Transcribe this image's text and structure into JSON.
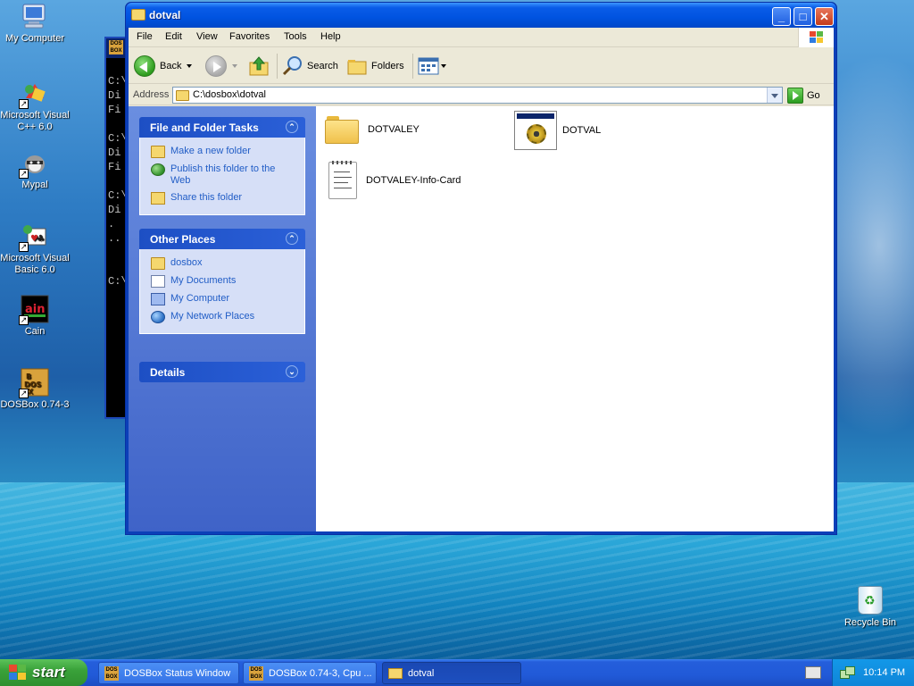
{
  "desktop": {
    "icons": [
      {
        "label": "My Computer",
        "icon": "my-computer-icon"
      },
      {
        "label": "Microsoft Visual C++ 6.0",
        "icon": "visual-cpp-icon"
      },
      {
        "label": "Mypal",
        "icon": "mypal-icon"
      },
      {
        "label": "Microsoft Visual Basic 6.0",
        "icon": "visual-basic-icon"
      },
      {
        "label": "Cain",
        "icon": "cain-icon"
      },
      {
        "label": "DOSBox 0.74-3",
        "icon": "dosbox-icon"
      }
    ],
    "recycle_bin": {
      "label": "Recycle Bin",
      "icon": "recycle-bin-icon"
    }
  },
  "dos_window": {
    "lines": [
      "C:\\",
      "Di",
      "Fi",
      "",
      "C:\\",
      "Di",
      "Fi",
      "",
      "C:\\",
      "Di",
      ".",
      "..",
      "",
      "",
      "C:\\"
    ]
  },
  "window": {
    "title": "dotval",
    "menu": [
      "File",
      "Edit",
      "View",
      "Favorites",
      "Tools",
      "Help"
    ],
    "toolbar": {
      "back": "Back",
      "search": "Search",
      "folders": "Folders"
    },
    "address": {
      "label": "Address",
      "value": "C:\\dosbox\\dotval",
      "go": "Go"
    },
    "tasks": {
      "file_folder_tasks": {
        "title": "File and Folder Tasks",
        "items": [
          "Make a new folder",
          "Publish this folder to the Web",
          "Share this folder"
        ]
      },
      "other_places": {
        "title": "Other Places",
        "items": [
          "dosbox",
          "My Documents",
          "My Computer",
          "My Network Places"
        ]
      },
      "details": {
        "title": "Details"
      }
    },
    "files": [
      {
        "name": "DOTVALEY",
        "type": "folder"
      },
      {
        "name": "DOTVAL",
        "type": "application"
      },
      {
        "name": "DOTVALEY-Info-Card",
        "type": "text"
      }
    ]
  },
  "taskbar": {
    "start": "start",
    "tasks": [
      {
        "label": "DOSBox Status Window",
        "active": false
      },
      {
        "label": "DOSBox 0.74-3, Cpu ...",
        "active": false
      },
      {
        "label": "dotval",
        "active": true
      }
    ],
    "clock": "10:14 PM"
  }
}
